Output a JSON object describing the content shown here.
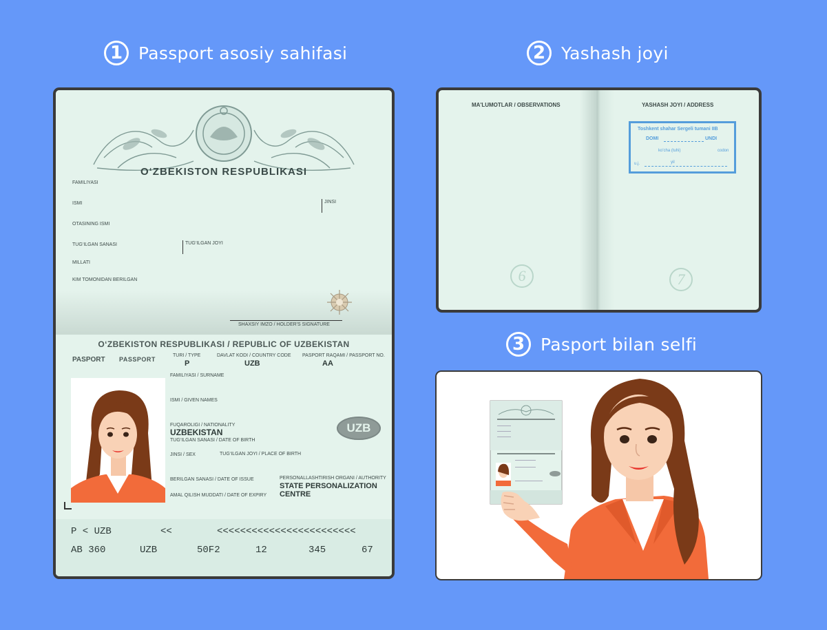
{
  "steps": [
    {
      "number": "1",
      "title": "Passport asosiy sahifasi"
    },
    {
      "number": "2",
      "title": "Yashash joyi"
    },
    {
      "number": "3",
      "title": "Pasport bilan selfi"
    }
  ],
  "passport_main": {
    "republic": "O‘ZBEKISTON RESPUBLIKASI",
    "fields_top": {
      "surname": "FAMILIYASI",
      "name": "ISMI",
      "sex": "JINSI",
      "patronymic": "OTASINING ISMI",
      "birth_date": "TUG‘ILGAN SANASI",
      "birth_place": "TUG‘ILGAN JOYI",
      "nationality": "MILLATI",
      "issued_by": "KIM TOMONIDAN BERILGAN",
      "signature": "SHAXSIY IMZO / HOLDER'S SIGNATURE"
    },
    "data_page": {
      "header": "O‘ZBEKISTON RESPUBLIKASI / REPUBLIC OF UZBEKISTAN",
      "pasport": "PASPORT",
      "passport": "PASSPORT",
      "type_label": "TURI / TYPE",
      "type_value": "P",
      "country_label": "DAVLAT KODI / COUNTRY CODE",
      "country_value": "UZB",
      "number_label": "PASPORT RAQAMI / PASSPORT No.",
      "number_value": "AA",
      "surname_label": "FAMILIYASI / SURNAME",
      "given_label": "ISMI / GIVEN NAMES",
      "nationality_label": "FUQAROLIGI / NATIONALITY",
      "nationality_value": "UZBEKISTAN",
      "dob_label": "TUG‘ILGAN SANASI / DATE OF BIRTH",
      "sex_label": "JINSI / SEX",
      "pob_label": "TUG‘ILGAN JOYI / PLACE OF BIRTH",
      "issue_label": "BERILGAN SANASI / DATE OF ISSUE",
      "expiry_label": "AMAL QILISH MUDDATI / DATE OF EXPIRY",
      "authority_label": "PERSONALLASHTIRISH ORGANI / AUTHORITY",
      "authority_value_1": "STATE PERSONALIZATION",
      "authority_value_2": "CENTRE",
      "badge": "UZB"
    },
    "mrz": {
      "line1": [
        "P < UZB",
        "<<",
        "<<<<<<<<<<<<<<<<<<<<<<<<"
      ],
      "line2": [
        "AB 360",
        "UZB",
        "50F2",
        "12",
        "345",
        "67"
      ]
    }
  },
  "address_page": {
    "left_title": "MA'LUMOTLAR / OBSERVATIONS",
    "right_title": "YASHASH JOYI / ADDRESS",
    "stamp_line1": "Toshkent shahar Sergeli tumani IIB",
    "stamp_line2": "DOMI",
    "stamp_line2b": "UNDI",
    "stamp_line3": "ko'cha (tuhi)",
    "stamp_line3b": "codon",
    "stamp_line4": "u.j.",
    "stamp_line4b": "yil",
    "page_left": "6",
    "page_right": "7"
  },
  "colors": {
    "background": "#6598f9",
    "passport_page": "#e4f3ec",
    "stamp": "#3b8fd9",
    "jacket": "#f26b3a",
    "hair": "#7a3a18"
  }
}
